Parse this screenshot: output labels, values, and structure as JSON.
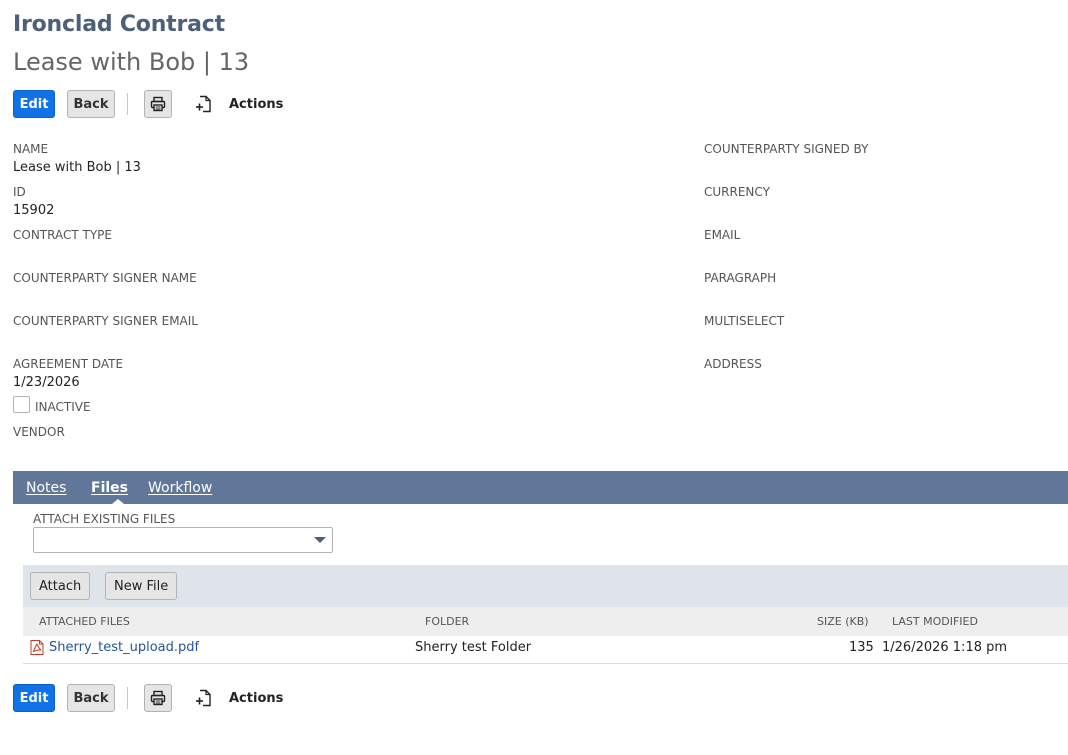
{
  "header": {
    "title": "Ironclad Contract",
    "subtitle": "Lease with Bob | 13"
  },
  "toolbar": {
    "edit_label": "Edit",
    "back_label": "Back",
    "actions_label": "Actions"
  },
  "fields_left": {
    "name_label": "NAME",
    "name_value": "Lease with Bob | 13",
    "id_label": "ID",
    "id_value": "15902",
    "contract_type_label": "CONTRACT TYPE",
    "signer_name_label": "COUNTERPARTY SIGNER NAME",
    "signer_email_label": "COUNTERPARTY SIGNER EMAIL",
    "agreement_date_label": "AGREEMENT DATE",
    "agreement_date_value": "1/23/2026",
    "inactive_label": "INACTIVE",
    "inactive_checked": false,
    "vendor_label": "VENDOR"
  },
  "fields_right": {
    "signed_by_label": "COUNTERPARTY SIGNED BY",
    "currency_label": "CURRENCY",
    "email_label": "EMAIL",
    "paragraph_label": "PARAGRAPH",
    "multiselect_label": "MULTISELECT",
    "address_label": "ADDRESS"
  },
  "tabs": {
    "notes": "Notes",
    "files": "Files",
    "workflow": "Workflow",
    "active": "Files"
  },
  "files": {
    "attach_existing_label": "ATTACH EXISTING FILES",
    "attach_existing_value": "",
    "attach_button": "Attach",
    "new_file_button": "New File",
    "columns": {
      "attached_files": "ATTACHED FILES",
      "folder": "FOLDER",
      "size": "SIZE (KB)",
      "last_modified": "LAST MODIFIED"
    },
    "rows": [
      {
        "name": "Sherry_test_upload.pdf",
        "folder": "Sherry test Folder",
        "size": "135",
        "modified": "1/26/2026 1:18 pm"
      }
    ]
  },
  "colors": {
    "title": "#4d5f79",
    "primary_button": "#1072e6",
    "tab_bar": "#607799",
    "link": "#255599",
    "button_bar": "#dfe4eb"
  },
  "icons": {
    "print": "printer-icon",
    "actions": "document-plus-icon",
    "pdf": "pdf-file-icon",
    "dropdown": "caret-down-icon"
  }
}
